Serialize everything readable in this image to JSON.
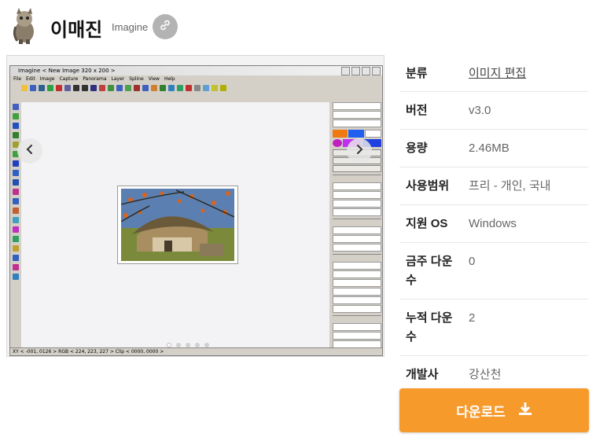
{
  "header": {
    "title": "이매진",
    "subtitle": "Imagine",
    "link_icon": "link-icon",
    "app_icon": "cat-icon"
  },
  "screenshot": {
    "window_title": "Imagine < New Image 320 x 200 >",
    "menu": [
      "File",
      "Edit",
      "Image",
      "Capture",
      "Panorama",
      "Layer",
      "Spline",
      "View",
      "Help"
    ],
    "panel_labels": [
      "Z",
      "A",
      "T",
      "Brush",
      "Paint",
      "Clip",
      "Filter",
      "Files",
      "AGIF",
      "Layer",
      "Brush Kind",
      "Solid",
      "None",
      "AntiAlias",
      "Texture Series",
      "Filter Brush",
      "Spline",
      "Catmull-Rom",
      "Hermit",
      "Bias",
      "FN",
      "Draw As Spline",
      "Magic Kind",
      "Move"
    ],
    "status": "XY < -001, 0126 > RGB < 224, 223, 227 > Clip < 0000, 0000 >",
    "slide_count": 5,
    "active_slide": 0
  },
  "info": [
    {
      "key": "분류",
      "value": "이미지 편집",
      "link": true
    },
    {
      "key": "버전",
      "value": "v3.0",
      "link": false
    },
    {
      "key": "용량",
      "value": "2.46MB",
      "link": false
    },
    {
      "key": "사용범위",
      "value": "프리 - 개인, 국내",
      "link": false
    },
    {
      "key": "지원 OS",
      "value": "Windows",
      "link": false
    },
    {
      "key": "금주 다운수",
      "value": "0",
      "link": false
    },
    {
      "key": "누적 다운수",
      "value": "2",
      "link": false
    },
    {
      "key": "개발사",
      "value": "강산천",
      "link": false
    }
  ],
  "download": {
    "label": "다운로드",
    "icon": "download-icon"
  },
  "colors": {
    "accent": "#f79a2c",
    "link_btn": "#b3b3b3"
  }
}
